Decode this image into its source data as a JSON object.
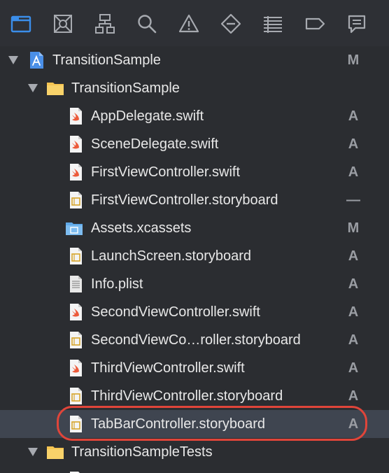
{
  "toolbar": {
    "icons": [
      {
        "name": "project-navigator-icon",
        "active": true
      },
      {
        "name": "source-control-navigator-icon"
      },
      {
        "name": "symbol-navigator-icon"
      },
      {
        "name": "find-navigator-icon"
      },
      {
        "name": "issue-navigator-icon"
      },
      {
        "name": "test-navigator-icon"
      },
      {
        "name": "debug-navigator-icon"
      },
      {
        "name": "breakpoint-navigator-icon"
      },
      {
        "name": "report-navigator-icon"
      }
    ],
    "active_color": "#3b8eea",
    "icon_color": "#a7aab0"
  },
  "tree": {
    "rows": [
      {
        "label": "TransitionSample",
        "status": "M",
        "icon": "project-icon",
        "expanded": true
      },
      {
        "label": "TransitionSample",
        "status": "",
        "icon": "folder-icon",
        "expanded": true
      },
      {
        "label": "AppDelegate.swift",
        "status": "A",
        "icon": "swift-file-icon"
      },
      {
        "label": "SceneDelegate.swift",
        "status": "A",
        "icon": "swift-file-icon"
      },
      {
        "label": "FirstViewController.swift",
        "status": "A",
        "icon": "swift-file-icon"
      },
      {
        "label": "FirstViewController.storyboard",
        "status": "—",
        "icon": "storyboard-file-icon"
      },
      {
        "label": "Assets.xcassets",
        "status": "M",
        "icon": "asset-catalog-icon"
      },
      {
        "label": "LaunchScreen.storyboard",
        "status": "A",
        "icon": "storyboard-file-icon"
      },
      {
        "label": "Info.plist",
        "status": "A",
        "icon": "plist-file-icon"
      },
      {
        "label": "SecondViewController.swift",
        "status": "A",
        "icon": "swift-file-icon"
      },
      {
        "label": "SecondViewCo…roller.storyboard",
        "status": "A",
        "icon": "storyboard-file-icon"
      },
      {
        "label": "ThirdViewController.swift",
        "status": "A",
        "icon": "swift-file-icon"
      },
      {
        "label": "ThirdViewController.storyboard",
        "status": "A",
        "icon": "storyboard-file-icon"
      },
      {
        "label": "TabBarController.storyboard",
        "status": "A",
        "icon": "storyboard-file-icon",
        "selected": true
      },
      {
        "label": "TransitionSampleTests",
        "status": "",
        "icon": "folder-icon",
        "expanded": true
      }
    ],
    "selected_color": "#3f4550",
    "highlight_ring_color": "#e0453a"
  }
}
